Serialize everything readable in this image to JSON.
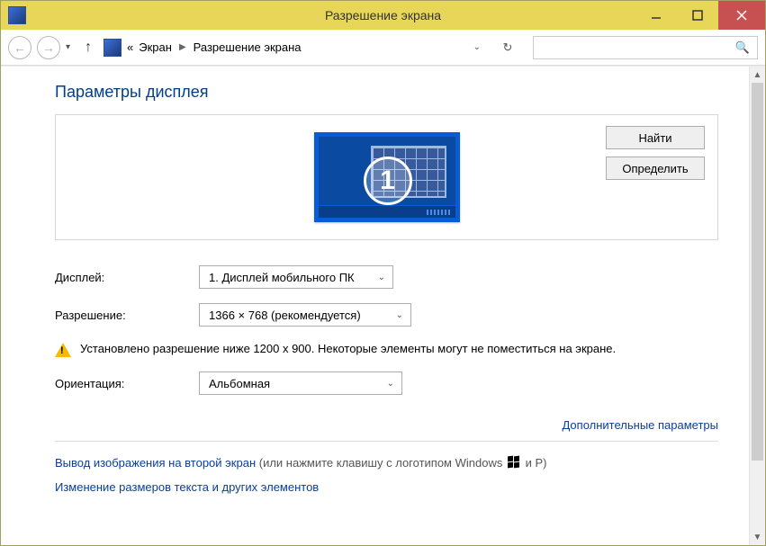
{
  "window": {
    "title": "Разрешение экрана"
  },
  "breadcrumb": {
    "prefix": "«",
    "seg1": "Экран",
    "seg2": "Разрешение экрана"
  },
  "header": {
    "title": "Параметры дисплея"
  },
  "monitor": {
    "number": "1"
  },
  "buttons": {
    "find": "Найти",
    "identify": "Определить"
  },
  "labels": {
    "display": "Дисплей:",
    "resolution": "Разрешение:",
    "orientation": "Ориентация:"
  },
  "combos": {
    "display": "1. Дисплей мобильного ПК",
    "resolution": "1366 × 768 (рекомендуется)",
    "orientation": "Альбомная"
  },
  "warning": "Установлено разрешение ниже 1200 x 900. Некоторые элементы могут не поместиться на экране.",
  "links": {
    "advanced": "Дополнительные параметры",
    "project_prefix": "Вывод изображения на второй экран",
    "project_suffix_a": " (или нажмите клавишу с логотипом Windows ",
    "project_suffix_b": " и P)",
    "textsize": "Изменение размеров текста и других элементов"
  }
}
